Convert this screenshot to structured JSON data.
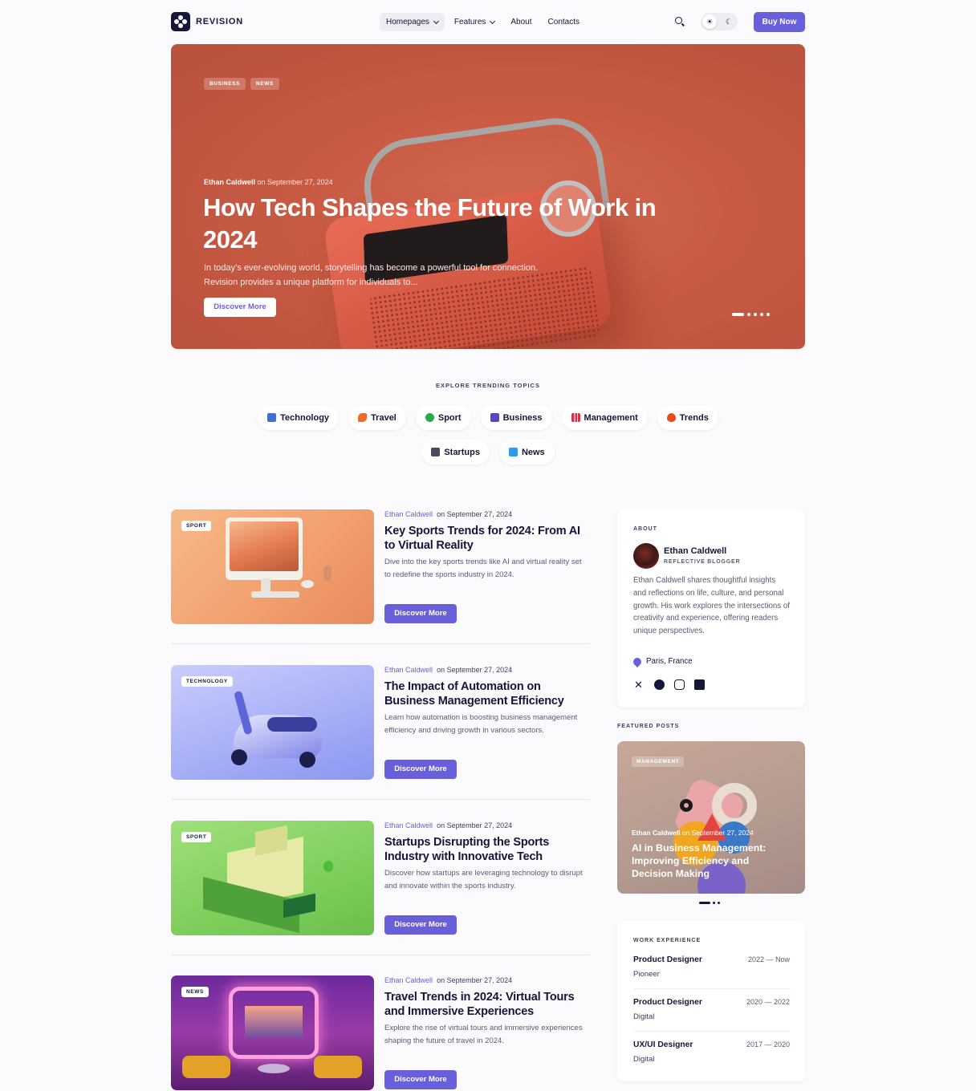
{
  "brand": {
    "name": "REVISION"
  },
  "nav": {
    "items": [
      {
        "label": "Homepages",
        "dropdown": true,
        "active": true
      },
      {
        "label": "Features",
        "dropdown": true,
        "active": false
      },
      {
        "label": "About",
        "dropdown": false,
        "active": false
      },
      {
        "label": "Contacts",
        "dropdown": false,
        "active": false
      }
    ],
    "search_icon": "search-icon",
    "theme_toggle": {
      "light_icon": "☀",
      "dark_icon": "☾"
    },
    "buy_label": "Buy Now"
  },
  "hero": {
    "tags": [
      "BUSINESS",
      "NEWS"
    ],
    "author": "Ethan Caldwell",
    "date_text": "on September 27, 2024",
    "title": "How Tech Shapes the Future of Work in 2024",
    "description": "In today’s ever-evolving world, storytelling has become a powerful tool for connection. Revision provides a unique platform for individuals to...",
    "button_label": "Discover More",
    "slide_count": 5,
    "active_slide": 1
  },
  "topics": {
    "label": "EXPLORE TRENDING TOPICS",
    "row1": [
      {
        "label": "Technology",
        "icon": "laptop-icon",
        "color": "#3b6fd9"
      },
      {
        "label": "Travel",
        "icon": "airplane-icon",
        "color": "#ef6a2b"
      },
      {
        "label": "Sport",
        "icon": "ball-icon",
        "color": "#2aa84a"
      },
      {
        "label": "Business",
        "icon": "briefcase-icon",
        "color": "#5546c9"
      },
      {
        "label": "Management",
        "icon": "chart-icon",
        "color": "#d2344d"
      },
      {
        "label": "Trends",
        "icon": "fire-icon",
        "color": "#ea4a1c"
      }
    ],
    "row2": [
      {
        "label": "Startups",
        "icon": "presentation-icon",
        "color": "#4a4a5a"
      },
      {
        "label": "News",
        "icon": "document-icon",
        "color": "#2f9be8"
      }
    ]
  },
  "articles": [
    {
      "category": "SPORT",
      "author": "Ethan Caldwell",
      "date_text": "on September 27, 2024",
      "title": "Key Sports Trends for 2024: From AI to Virtual Reality",
      "description": "Dive into the key sports trends like AI and virtual reality set to redefine the sports industry in 2024.",
      "button_label": "Discover More"
    },
    {
      "category": "TECHNOLOGY",
      "author": "Ethan Caldwell",
      "date_text": "on September 27, 2024",
      "title": "The Impact of Automation on Business Management Efficiency",
      "description": "Learn how automation is boosting business management efficiency and driving growth in various sectors.",
      "button_label": "Discover More"
    },
    {
      "category": "SPORT",
      "author": "Ethan Caldwell",
      "date_text": "on September 27, 2024",
      "title": "Startups Disrupting the Sports Industry with Innovative Tech",
      "description": "Discover how startups are leveraging technology to disrupt and innovate within the sports industry.",
      "button_label": "Discover More"
    },
    {
      "category": "NEWS",
      "author": "Ethan Caldwell",
      "date_text": "on September 27, 2024",
      "title": "Travel Trends in 2024: Virtual Tours and Immersive Experiences",
      "description": "Explore the rise of virtual tours and immersive experiences shaping the future of travel in 2024.",
      "button_label": "Discover More"
    }
  ],
  "sidebar": {
    "about": {
      "label": "ABOUT",
      "name": "Ethan Caldwell",
      "role": "REFLECTIVE BLOGGER",
      "bio": "Ethan Caldwell shares thoughtful insights and reflections on life, culture, and personal growth. His work explores the intersections of creativity and experience, offering readers unique perspectives.",
      "location": "Paris, France",
      "social": [
        "x-icon",
        "facebook-icon",
        "instagram-icon",
        "linkedin-icon"
      ]
    },
    "featured": {
      "label": "FEATURED POSTS",
      "tag": "MANAGEMENT",
      "author": "Ethan Caldwell",
      "date_text": "on September 27, 2024",
      "title": "AI in Business Management: Improving Efficiency and Decision Making",
      "slide_count": 3,
      "active_slide": 1
    },
    "work": {
      "label": "WORK EXPERIENCE",
      "jobs": [
        {
          "role": "Product Designer",
          "company": "Pioneer",
          "years": "2022 — Now"
        },
        {
          "role": "Product Designer",
          "company": "Digital",
          "years": "2020 — 2022"
        },
        {
          "role": "UX/UI Designer",
          "company": "Digital",
          "years": "2017 — 2020"
        }
      ]
    }
  },
  "colors": {
    "accent": "#6a5fdb",
    "ink": "#16153a",
    "hero_bg": "#c85a43",
    "page_bg": "#fbfbfe"
  }
}
